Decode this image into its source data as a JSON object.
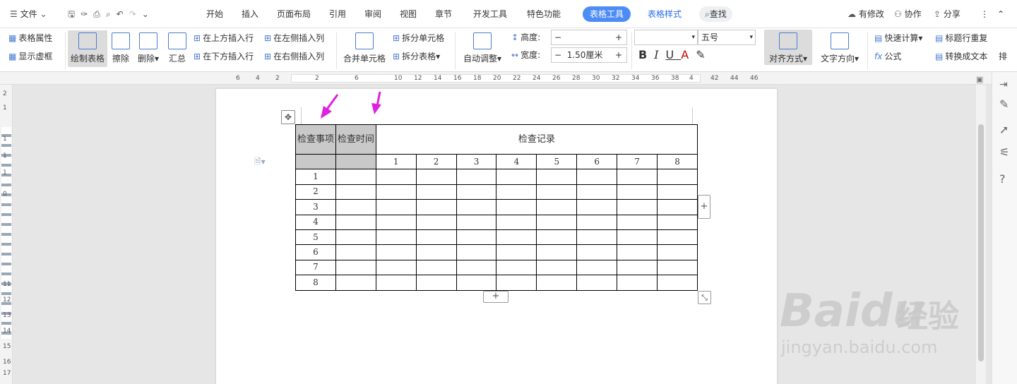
{
  "menu": {
    "file": "文件",
    "tabs": [
      "开始",
      "插入",
      "页面布局",
      "引用",
      "审阅",
      "视图",
      "章节",
      "开发工具",
      "特色功能"
    ],
    "active_tab": "表格工具",
    "style_tab": "表格样式",
    "search": "查找",
    "right": [
      "有修改",
      "协作",
      "分享"
    ]
  },
  "ribbon": {
    "table_props": "表格属性",
    "show_grid": "显示虚框",
    "draw_table": "绘制表格",
    "erase": "擦除",
    "delete": "删除",
    "summary": "汇总",
    "ins_above": "在上方插入行",
    "ins_below": "在下方插入行",
    "ins_left": "在左侧插入列",
    "ins_right": "在右侧插入列",
    "merge": "合并单元格",
    "split_cell": "拆分单元格",
    "split_table": "拆分表格",
    "auto_fit": "自动调整",
    "height_label": "高度:",
    "height_value": "",
    "width_label": "宽度:",
    "width_value": "1.50厘米",
    "font_name": "",
    "font_size": "五号",
    "align": "对齐方式",
    "text_dir": "文字方向",
    "quick_calc": "快速计算",
    "formula": "公式",
    "header_repeat": "标题行重复",
    "to_text": "转换成文本",
    "sort_short": "排"
  },
  "hruler": [
    "6",
    "4",
    "2",
    "2",
    "6",
    "10",
    "12",
    "14",
    "16",
    "18",
    "20",
    "22",
    "24",
    "26",
    "28",
    "30",
    "32",
    "34",
    "36",
    "38",
    "4",
    "42",
    "44",
    "46"
  ],
  "vruler": [
    "2",
    "1",
    "1",
    "1",
    "1",
    "0",
    "11",
    "12",
    "13",
    "14",
    "15",
    "16",
    "17"
  ],
  "table": {
    "h1": "检查事项",
    "h2": "检查时间",
    "h3": "检查记录",
    "cols": [
      "1",
      "2",
      "3",
      "4",
      "5",
      "6",
      "7",
      "8"
    ],
    "rows": [
      "1",
      "2",
      "3",
      "4",
      "5",
      "6",
      "7",
      "8"
    ]
  },
  "watermark": {
    "main": "Bai",
    "paw": "du",
    "cn": "经验",
    "url": "jingyan.baidu.com"
  },
  "colors": {
    "accent": "#4d8cf5",
    "arrow": "#e020e0"
  }
}
